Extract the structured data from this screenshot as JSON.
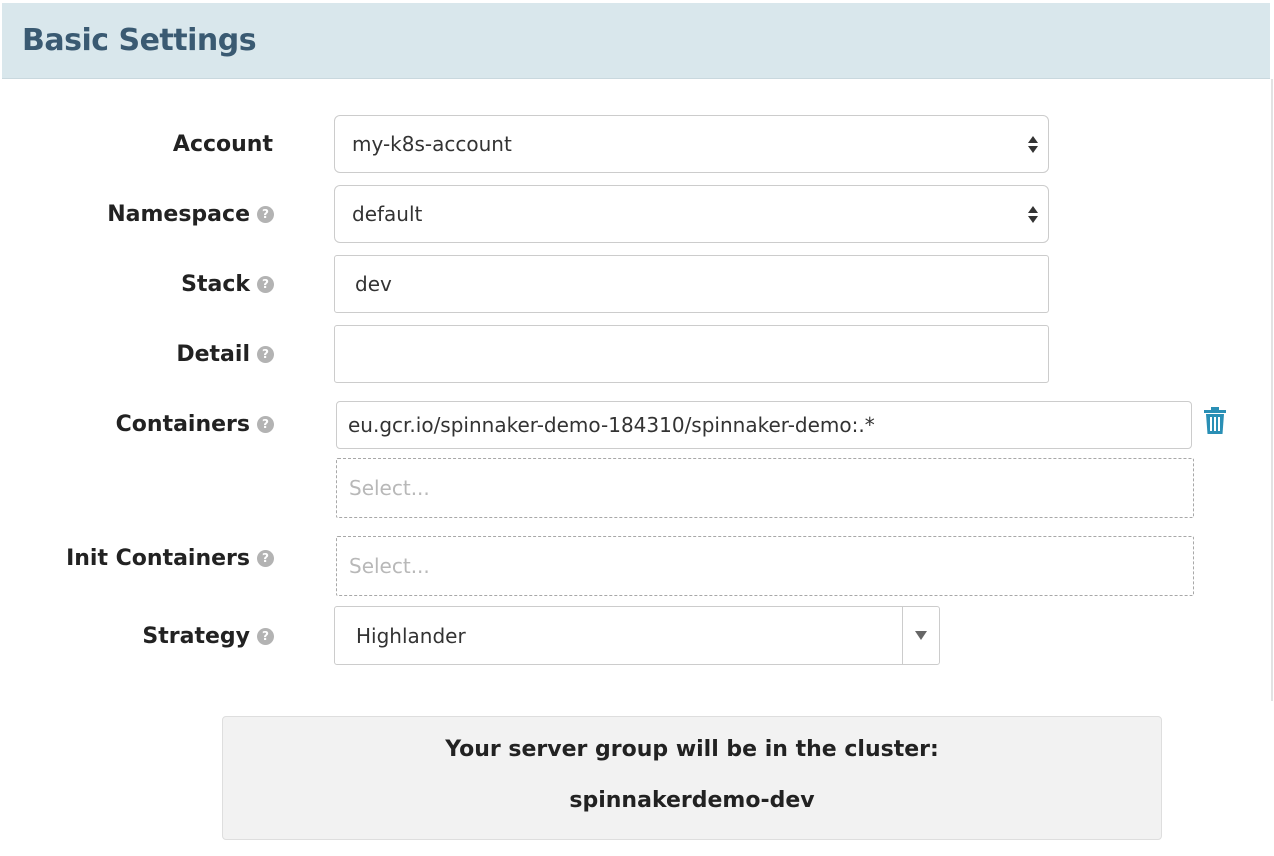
{
  "header": {
    "title": "Basic Settings"
  },
  "form": {
    "account": {
      "label": "Account",
      "value": "my-k8s-account"
    },
    "namespace": {
      "label": "Namespace",
      "value": "default"
    },
    "stack": {
      "label": "Stack",
      "value": "dev"
    },
    "detail": {
      "label": "Detail",
      "value": ""
    },
    "containers": {
      "label": "Containers",
      "value": "eu.gcr.io/spinnaker-demo-184310/spinnaker-demo:.*",
      "select_placeholder": "Select..."
    },
    "init_containers": {
      "label": "Init Containers",
      "select_placeholder": "Select..."
    },
    "strategy": {
      "label": "Strategy",
      "value": "Highlander"
    }
  },
  "help_glyph": "?",
  "cluster": {
    "label": "Your server group will be in the cluster:",
    "name": "spinnakerdemo-dev"
  },
  "icons": {
    "help": "question-circle-icon",
    "trash": "trash-icon",
    "select_arrows": "sort-arrows-icon",
    "caret": "caret-down-icon"
  },
  "colors": {
    "header_bg": "#d9e7ec",
    "header_text": "#3a5a72",
    "trash": "#2a8fb5"
  }
}
